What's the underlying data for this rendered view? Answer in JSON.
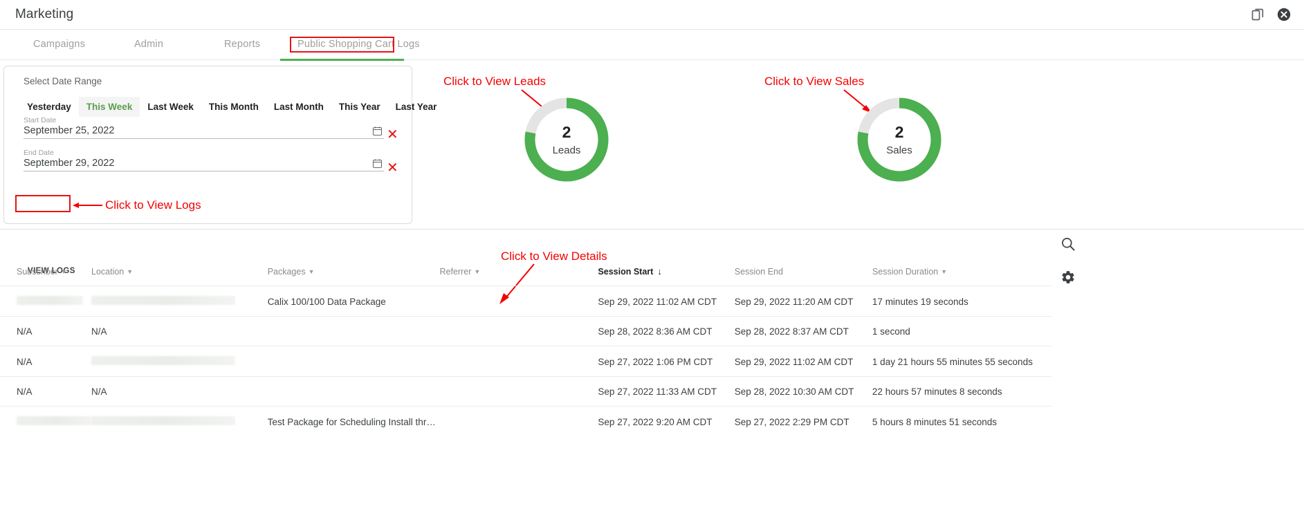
{
  "header": {
    "title": "Marketing",
    "icons": [
      {
        "name": "restore-window-icon",
        "glyph": "❐"
      },
      {
        "name": "close-circle-icon",
        "glyph": "✖"
      }
    ]
  },
  "tabs": [
    {
      "label": "Campaigns",
      "active": false
    },
    {
      "label": "Admin",
      "active": false
    },
    {
      "label": "Reports",
      "active": false
    },
    {
      "label": "Public Shopping Cart Logs",
      "active": true
    }
  ],
  "date_card": {
    "legend": "Select Date Range",
    "presets": [
      {
        "label": "Yesterday",
        "selected": false
      },
      {
        "label": "This Week",
        "selected": true
      },
      {
        "label": "Last Week",
        "selected": false
      },
      {
        "label": "This Month",
        "selected": false
      },
      {
        "label": "Last Month",
        "selected": false
      },
      {
        "label": "This Year",
        "selected": false
      },
      {
        "label": "Last Year",
        "selected": false
      }
    ],
    "start": {
      "label": "Start Date",
      "value": "September 25, 2022"
    },
    "end": {
      "label": "End Date",
      "value": "September 29, 2022"
    },
    "view_logs_label": "VIEW LOGS"
  },
  "annotations": {
    "logs": "Click to View Logs",
    "leads": "Click to View Leads",
    "sales": "Click to View Sales",
    "details": "Click to View Details",
    "color": "#f40000"
  },
  "chart_data": [
    {
      "type": "pie",
      "title": "Leads",
      "center_value": "2",
      "center_label": "Leads",
      "categories": [
        "Leads",
        "Remaining"
      ],
      "values": [
        78,
        22
      ],
      "colors": [
        "#4caf50",
        "#e4e4e4"
      ],
      "legend": "none"
    },
    {
      "type": "pie",
      "title": "Sales",
      "center_value": "2",
      "center_label": "Sales",
      "categories": [
        "Sales",
        "Remaining"
      ],
      "values": [
        78,
        22
      ],
      "colors": [
        "#4caf50",
        "#e4e4e4"
      ],
      "legend": "none"
    }
  ],
  "table": {
    "search_icon": "search-icon",
    "settings_icon": "gear-icon",
    "columns": [
      {
        "label": "Subscriber",
        "sortable": true,
        "sorted": false
      },
      {
        "label": "Location",
        "sortable": true,
        "sorted": false
      },
      {
        "label": "Packages",
        "sortable": true,
        "sorted": false
      },
      {
        "label": "Referrer",
        "sortable": true,
        "sorted": false
      },
      {
        "label": "Session Start",
        "sortable": true,
        "sorted": true,
        "sort_dir": "↓"
      },
      {
        "label": "Session End",
        "sortable": false,
        "sorted": false
      },
      {
        "label": "Session Duration",
        "sortable": true,
        "sorted": false
      }
    ],
    "rows": [
      {
        "subscriber": "",
        "subscriber_redacted": true,
        "location": "",
        "location_redacted": true,
        "packages": "Calix 100/100 Data Package",
        "referrer": "",
        "session_start": "Sep 29, 2022 11:02 AM CDT",
        "session_end": "Sep 29, 2022 11:20 AM CDT",
        "session_duration": "17 minutes 19 seconds"
      },
      {
        "subscriber": "N/A",
        "subscriber_redacted": false,
        "location": "N/A",
        "location_redacted": false,
        "packages": "",
        "referrer": "",
        "session_start": "Sep 28, 2022 8:36 AM CDT",
        "session_end": "Sep 28, 2022 8:37 AM CDT",
        "session_duration": "1 second"
      },
      {
        "subscriber": "N/A",
        "subscriber_redacted": false,
        "location": "",
        "location_redacted": true,
        "packages": "",
        "referrer": "",
        "session_start": "Sep 27, 2022 1:06 PM CDT",
        "session_end": "Sep 29, 2022 11:02 AM CDT",
        "session_duration": "1 day 21 hours 55 minutes 55 seconds"
      },
      {
        "subscriber": "N/A",
        "subscriber_redacted": false,
        "location": "N/A",
        "location_redacted": false,
        "packages": "",
        "referrer": "",
        "session_start": "Sep 27, 2022 11:33 AM CDT",
        "session_end": "Sep 28, 2022 10:30 AM CDT",
        "session_duration": "22 hours 57 minutes 8 seconds"
      },
      {
        "subscriber": "",
        "subscriber_redacted": true,
        "location": "",
        "location_redacted": true,
        "packages": "Test Package for Scheduling Install thr…",
        "referrer": "",
        "session_start": "Sep 27, 2022 9:20 AM CDT",
        "session_end": "Sep 27, 2022 2:29 PM CDT",
        "session_duration": "5 hours 8 minutes 51 seconds"
      }
    ]
  }
}
